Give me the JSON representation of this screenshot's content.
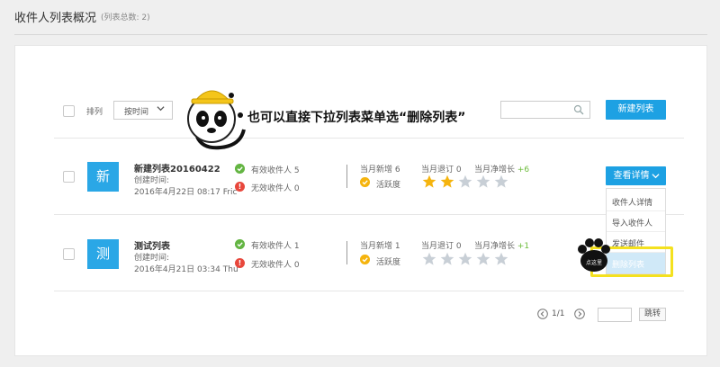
{
  "header": {
    "title": "收件人列表概况",
    "count": "(列表总数: 2)"
  },
  "toolbar": {
    "sort_label": "排列",
    "sort_value": "按时间",
    "search_placeholder": "",
    "new_list_label": "新建列表"
  },
  "lists": [
    {
      "icon_char": "新",
      "name": "新建列表20160422",
      "created_label": "创建时间:",
      "created_value": "2016年4月22日 08:17 Fric",
      "valid_label": "有效收件人",
      "valid_count": "5",
      "invalid_label": "无效收件人",
      "invalid_count": "0",
      "new_label": "当月新增",
      "new_count": "6",
      "unsub_label": "当月退订",
      "unsub_count": "0",
      "growth_label": "当月净增长",
      "growth_value": "+6",
      "activity_label": "活跃度",
      "activity_stars": 2,
      "activity_max": 5
    },
    {
      "icon_char": "测",
      "name": "测试列表",
      "created_label": "创建时间:",
      "created_value": "2016年4月21日 03:34 Thu",
      "valid_label": "有效收件人",
      "valid_count": "1",
      "invalid_label": "无效收件人",
      "invalid_count": "0",
      "new_label": "当月新增",
      "new_count": "1",
      "unsub_label": "当月退订",
      "unsub_count": "0",
      "growth_label": "当月净增长",
      "growth_value": "+1",
      "activity_label": "活跃度",
      "activity_stars": 0,
      "activity_max": 5
    }
  ],
  "details_button": "查看详情",
  "dropdown": {
    "items": [
      "收件人详情",
      "导入收件人",
      "发送邮件",
      "删除列表"
    ]
  },
  "paw_label": "点这里",
  "pagination": {
    "page": "1/1",
    "goto_value": "",
    "goto_label": "跳转"
  },
  "tutorial_text": "也可以直接下拉列表菜单选“删除列表”",
  "colors": {
    "accent": "#1da1e3",
    "valid": "#64b543",
    "invalid": "#e8473c",
    "star_on": "#f5b40e",
    "star_off": "#c8cfd6",
    "highlight": "#f4e11f"
  }
}
